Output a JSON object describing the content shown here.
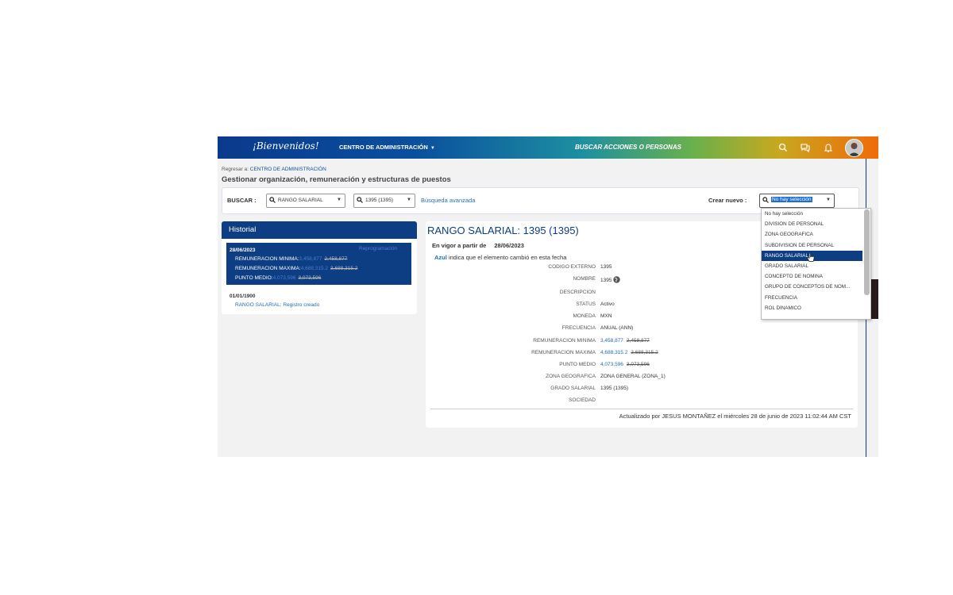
{
  "header": {
    "logo": "¡Bienvenidos!",
    "admin_menu": "CENTRO DE ADMINISTRACIÓN",
    "search_actions": "BUSCAR ACCIONES O PERSONAS"
  },
  "breadcrumb": {
    "prefix": "Regresar a:",
    "link": "CENTRO DE ADMINISTRACIÓN"
  },
  "page_title": "Gestionar organización, remuneración y estructuras de puestos",
  "search": {
    "label": "BUSCAR :",
    "type_value": "RANGO SALARIAL",
    "record_value": "1395 (1395)",
    "advanced": "Búsqueda avanzada",
    "create_label": "Crear nuevo :",
    "create_value": "No hay selección"
  },
  "create_menu": {
    "options": [
      "No hay selección",
      "DIVISION DE PERSONAL",
      "ZONA GEOGRAFICA",
      "SUBDIVISION DE PERSONAL",
      "RANGO SALARIAL",
      "GRADO SALARIAL",
      "CONCEPTO DE NOMINA",
      "GRUPO DE CONCEPTOS DE NOM...",
      "FRECUENCIA",
      "ROL DINAMICO"
    ],
    "selected": "RANGO SALARIAL"
  },
  "history": {
    "title": "Historial",
    "entry1": {
      "date": "28/06/2023",
      "reschedule": "Reprogramación",
      "rows": [
        {
          "label": "REMUNERACION MINIMA:",
          "new": "3,458,877",
          "old": "2,458,877"
        },
        {
          "label": "REMUNERACION MAXIMA:",
          "new": "4,688,315.2",
          "old": "3,688,315.2"
        },
        {
          "label": "PUNTO MEDIO:",
          "new": "4,073,596",
          "old": "3,073,596"
        }
      ]
    },
    "entry2": {
      "date": "01/01/1900",
      "text": "RANGO SALARIAL: Registro creado"
    }
  },
  "detail": {
    "title": "RANGO SALARIAL: 1395 (1395)",
    "effective_label": "En vigor a partir de",
    "effective_date": "28/06/2023",
    "legend_color": "Azul",
    "legend_text": "indica que el elemento cambió en esta fecha",
    "fields": {
      "codigo_externo": {
        "label": "CODIGO EXTERNO",
        "value": "1395"
      },
      "nombre": {
        "label": "NOMBRE",
        "value": "1395"
      },
      "descripcion": {
        "label": "DESCRIPCION",
        "value": ""
      },
      "status": {
        "label": "STATUS",
        "value": "Activo"
      },
      "moneda": {
        "label": "MONEDA",
        "value": "MXN"
      },
      "frecuencia": {
        "label": "FRECUENCIA",
        "value": "ANUAL",
        "extra": "(ANN)"
      },
      "rem_min": {
        "label": "REMUNERACION MINIMA",
        "new": "3,458,877",
        "old": "2,458,877"
      },
      "rem_max": {
        "label": "REMUNERACION MAXIMA",
        "new": "4,688,315.2",
        "old": "3,688,315.2"
      },
      "punto_medio": {
        "label": "PUNTO MEDIO",
        "new": "4,073,596",
        "old": "3,073,596"
      },
      "zona": {
        "label": "ZONA GEOGRAFICA",
        "value": "ZONA GENERAL",
        "extra": "(ZONA_1)"
      },
      "grado": {
        "label": "GRADO SALARIAL",
        "value": "1395 (1395)"
      },
      "sociedad": {
        "label": "SOCIEDAD",
        "value": ""
      }
    },
    "updated": "Actualizado por JESUS MONTAÑEZ el miércoles 28 de junio de 2023 11:02:44 AM CST"
  },
  "colors": {
    "brand_blue": "#0d3d82",
    "link_blue": "#1f6fb8",
    "accent_orange": "#f06a0a"
  }
}
